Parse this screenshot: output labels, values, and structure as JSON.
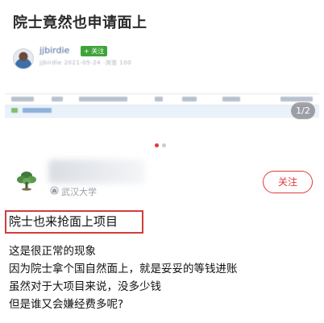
{
  "post": {
    "title": "院士竟然也申请面上"
  },
  "embedded_screenshot": {
    "author_name": "jjbirdie",
    "author_badge": "+ 关注",
    "author_meta": "jjbirdie 2021-05-24 ·浏览 100",
    "page_indicator": "1/2",
    "carousel_active_color": "#e4393c",
    "carousel_inactive_color": "#cccccc"
  },
  "user": {
    "school": "武汉大学",
    "follow_label": "关注",
    "accent_color": "#e4393c"
  },
  "answer": {
    "highlight_title": "院士也来抢面上项目",
    "lines": [
      "这是很正常的现象",
      "因为院士拿个国自然面上，就是妥妥的等钱进账",
      "虽然对于大项目来说，没多少钱",
      "但是谁又会嫌经费多呢?"
    ]
  }
}
